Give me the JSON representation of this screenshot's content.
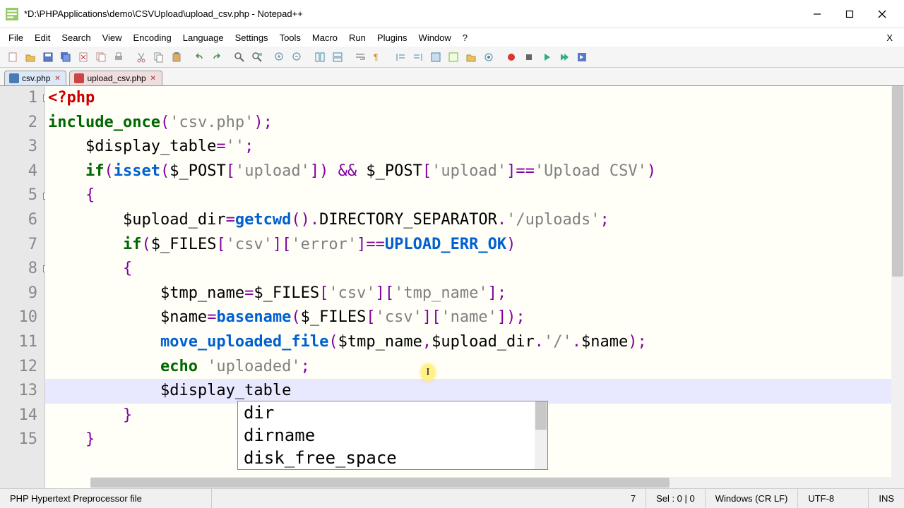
{
  "title": "*D:\\PHPApplications\\demo\\CSVUpload\\upload_csv.php - Notepad++",
  "menu": [
    "File",
    "Edit",
    "Search",
    "View",
    "Encoding",
    "Language",
    "Settings",
    "Tools",
    "Macro",
    "Run",
    "Plugins",
    "Window",
    "?"
  ],
  "tabs": [
    {
      "label": "csv.php",
      "active": false
    },
    {
      "label": "upload_csv.php",
      "active": true
    }
  ],
  "lines": {
    "count": 15,
    "current": 13
  },
  "cursor_glyph": "I",
  "autocomplete": [
    "dir",
    "dirname",
    "disk_free_space"
  ],
  "status": {
    "lang": "PHP Hypertext Preprocessor file",
    "pos_col": "7",
    "sel": "Sel : 0 | 0",
    "eol": "Windows (CR LF)",
    "enc": "UTF-8",
    "mode": "INS"
  },
  "code": {
    "l1_tag": "<?php",
    "l2_kw": "include_once",
    "l2_str": "'csv.php'",
    "l3_var": "$display_table",
    "l3_val": "''",
    "l4_if": "if",
    "l4_isset": "isset",
    "l4_post": "$_POST",
    "l4_key_upload": "'upload'",
    "l4_eq": "==",
    "l4_str": "'Upload CSV'",
    "l6_var": "$upload_dir",
    "l6_fn": "getcwd",
    "l6_const": "DIRECTORY_SEPARATOR",
    "l6_str": "'/uploads'",
    "l7_if": "if",
    "l7_files": "$_FILES",
    "l7_csv": "'csv'",
    "l7_err": "'error'",
    "l7_const": "UPLOAD_ERR_OK",
    "l9_var": "$tmp_name",
    "l9_files": "$_FILES",
    "l9_csv": "'csv'",
    "l9_tmp": "'tmp_name'",
    "l10_var": "$name",
    "l10_fn": "basename",
    "l10_files": "$_FILES",
    "l10_csv": "'csv'",
    "l10_name": "'name'",
    "l11_fn": "move_uploaded_file",
    "l11_a": "$tmp_name",
    "l11_b": "$upload_dir",
    "l11_slash": "'/'",
    "l11_c": "$name",
    "l12_echo": "echo",
    "l12_str": "'uploaded'",
    "l13_var": "$display_table"
  }
}
